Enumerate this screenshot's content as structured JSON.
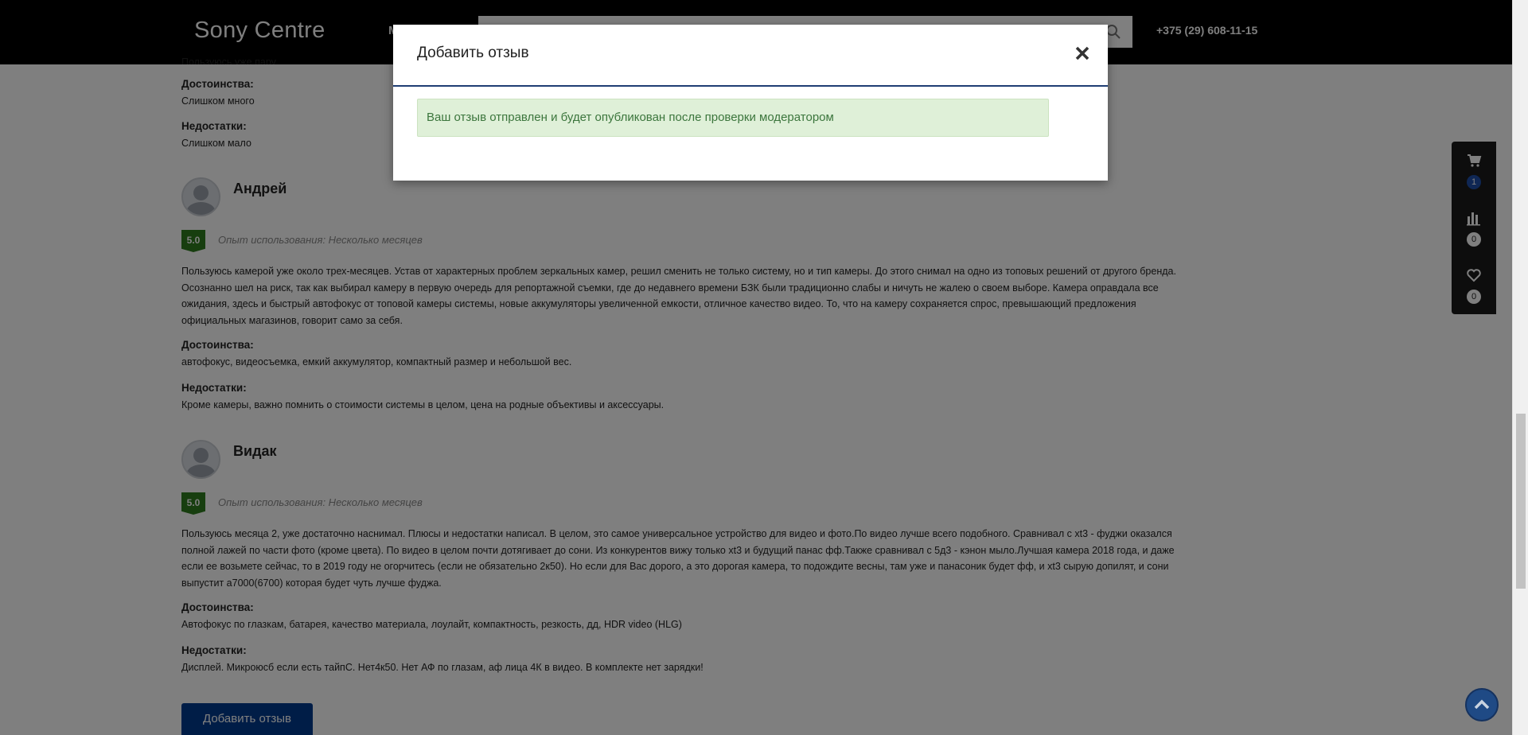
{
  "header": {
    "logo": "Sony Centre",
    "nav_stub": "M",
    "phone": "+375 (29) 608-11-15"
  },
  "top_partial": {
    "text": "Пользуюсь уже пару месяцев",
    "pros_label": "Достоинства:",
    "pros_text": "Слишком много",
    "cons_label": "Недостатки:",
    "cons_text": "Слишком мало"
  },
  "reviews": [
    {
      "name": "Андрей",
      "rating": "5.0",
      "experience": "Опыт использования: Несколько месяцев",
      "text": "Пользуюсь камерой уже около трех-месяцев. Устав от характерных проблем зеркальных камер, решил сменить не только систему, но и тип камеры. До этого снимал на одно из топовых решений от другого бренда. Осознанно шел на риск, так как выбирал камеру в первую очередь для репортажной съемки, где до недавнего времени БЗК были традиционно слабы и ничуть не жалею о своем выборе. Камера оправдала все ожидания, здесь и быстрый автофокус от топовой камеры системы, новые аккумуляторы увеличенной емкости, отличное качество видео. То, что на камеру сохраняется спрос, превышающий предложения официальных магазинов, говорит само за себя.",
      "pros_label": "Достоинства:",
      "pros": "автофокус, видеосъемка, емкий аккумулятор, компактный размер и небольшой вес.",
      "cons_label": "Недостатки:",
      "cons": "Кроме камеры, важно помнить о стоимости системы в целом, цена на родные объективы и аксессуары."
    },
    {
      "name": "Видак",
      "rating": "5.0",
      "experience": "Опыт использования: Несколько месяцев",
      "text": "Пользуюсь месяца 2, уже достаточно наснимал. Плюсы и недостатки написал. В целом, это самое универсальное устройство для видео и фото.По видео лучше всего подобного. Сравнивал с xt3 - фуджи оказался полной лажей по части фото (кроме цвета). По видео в целом почти дотягивает до сони. Из конкурентов вижу только xt3 и будущий панас фф.Также сравнивал с 5д3 - кэнон мыло.Лучшая камера 2018 года, и даже если ее возьмете сейчас, то в 2019 году не огорчитесь (если не обязательно 2к50). Но если для Вас дорого, а это дорогая камера, то подождите весны, там уже и панасоник будет фф, и xt3 сырую допилят, и сони выпустит а7000(6700) которая будет чуть лучше фуджа.",
      "pros_label": "Достоинства:",
      "pros": "Автофокус по глазкам, батарея, качество материала, лоулайт, компактность, резкость, дд, HDR video (HLG)",
      "cons_label": "Недостатки:",
      "cons": "Дисплей. Микроюсб если есть тайпС. Нет4к50. Нет АФ по глазам, аф лица 4К в видео. В комплекте нет зарядки!"
    }
  ],
  "add_review_button": "Добавить отзыв",
  "side_panel": {
    "cart_count": "1",
    "compare_count": "0",
    "favorites_count": "0"
  },
  "modal": {
    "title": "Добавить отзыв",
    "alert": "Ваш отзыв отправлен и будет опубликован после проверки модератором"
  },
  "colors": {
    "header_bg": "#000000",
    "accent_blue": "#003b8e",
    "rating_green": "#2e7d1e",
    "alert_bg": "#dff0d8",
    "alert_text": "#3c763d"
  }
}
